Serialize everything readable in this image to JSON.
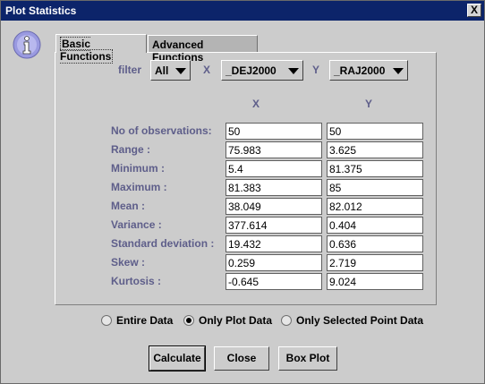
{
  "window": {
    "title": "Plot Statistics",
    "close_label": "X"
  },
  "icons": {
    "info": "info-icon",
    "close": "close-icon",
    "dropdown": "chevron-down-icon"
  },
  "tabs": [
    {
      "label": "Basic Functions",
      "selected": true
    },
    {
      "label": "Advanced Functions",
      "selected": false
    }
  ],
  "controls": {
    "filter_label": "filter",
    "filter_value": "All",
    "x_label": "X",
    "x_value": "_DEJ2000",
    "y_label": "Y",
    "y_value": "_RAJ2000"
  },
  "table": {
    "col_x": "X",
    "col_y": "Y",
    "rows": [
      {
        "label": "No of observations:",
        "x": "50",
        "y": "50"
      },
      {
        "label": "Range :",
        "x": "75.983",
        "y": "3.625"
      },
      {
        "label": "Minimum :",
        "x": "5.4",
        "y": "81.375"
      },
      {
        "label": "Maximum :",
        "x": "81.383",
        "y": "85"
      },
      {
        "label": "Mean :",
        "x": "38.049",
        "y": "82.012"
      },
      {
        "label": "Variance :",
        "x": "377.614",
        "y": "0.404"
      },
      {
        "label": "Standard deviation :",
        "x": "19.432",
        "y": "0.636"
      },
      {
        "label": "Skew :",
        "x": "0.259",
        "y": "2.719"
      },
      {
        "label": "Kurtosis :",
        "x": "-0.645",
        "y": "9.024"
      }
    ]
  },
  "radios": [
    {
      "label": "Entire Data",
      "checked": false
    },
    {
      "label": "Only Plot Data",
      "checked": true
    },
    {
      "label": "Only Selected Point Data",
      "checked": false
    }
  ],
  "buttons": {
    "calculate": "Calculate",
    "close": "Close",
    "boxplot": "Box Plot"
  },
  "colors": {
    "titlebar": "#0c246a",
    "label_text": "#5e5e8a",
    "background": "#cccccc"
  }
}
